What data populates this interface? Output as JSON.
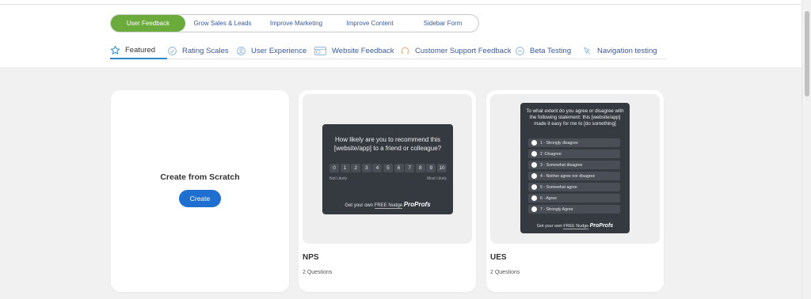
{
  "template_categories": [
    {
      "label": "User Feedback",
      "active": true
    },
    {
      "label": "Grow Sales & Leads",
      "active": false
    },
    {
      "label": "Improve Marketing",
      "active": false
    },
    {
      "label": "Improve Content",
      "active": false
    },
    {
      "label": "Sidebar Form",
      "active": false
    }
  ],
  "sub_tabs": [
    {
      "label": "Featured",
      "icon": "star-icon",
      "active": true
    },
    {
      "label": "Rating Scales",
      "icon": "rating-icon",
      "active": false
    },
    {
      "label": "User Experience",
      "icon": "user-experience-icon",
      "active": false
    },
    {
      "label": "Website Feedback",
      "icon": "website-icon",
      "active": false
    },
    {
      "label": "Customer Support Feedback",
      "icon": "headset-icon",
      "active": false
    },
    {
      "label": "Beta Testing",
      "icon": "beta-icon",
      "active": false
    },
    {
      "label": "Navigation testing",
      "icon": "cursor-icon",
      "active": false
    }
  ],
  "scratch_card": {
    "title": "Create from Scratch",
    "button": "Create"
  },
  "nps_card": {
    "question": "How likely are you to recommend this [website/app] to a friend or colleague?",
    "scale": [
      "0",
      "1",
      "2",
      "3",
      "4",
      "5",
      "6",
      "7",
      "8",
      "9",
      "10"
    ],
    "low_label": "Not Likely",
    "high_label": "Most Likely",
    "powered_prefix": "Get your own",
    "powered_free": "FREE Nudge",
    "brand": "ProProfs",
    "name": "NPS",
    "questions": "2 Questions"
  },
  "ues_card": {
    "question": "To what extent do you agree or disagree with the following statement: this [website/app] made it easy for me to [do something]",
    "options": [
      "1 - Strongly disagree",
      "2 -Disagree",
      "3 - Somewhat disagree",
      "4 - Neither agree nor disagree",
      "5 - Somewhat agree",
      "6 - Agree",
      "7 - Strongly Agree"
    ],
    "powered_prefix": "Get your own",
    "powered_free": "FREE Nudge",
    "brand": "ProProfs",
    "name": "UES",
    "questions": "2 Questions"
  },
  "colors": {
    "accent_green": "#6aab3c",
    "primary_blue": "#1f6fd1",
    "link_blue": "#3a5a9a",
    "widget_dark": "#353a41"
  }
}
